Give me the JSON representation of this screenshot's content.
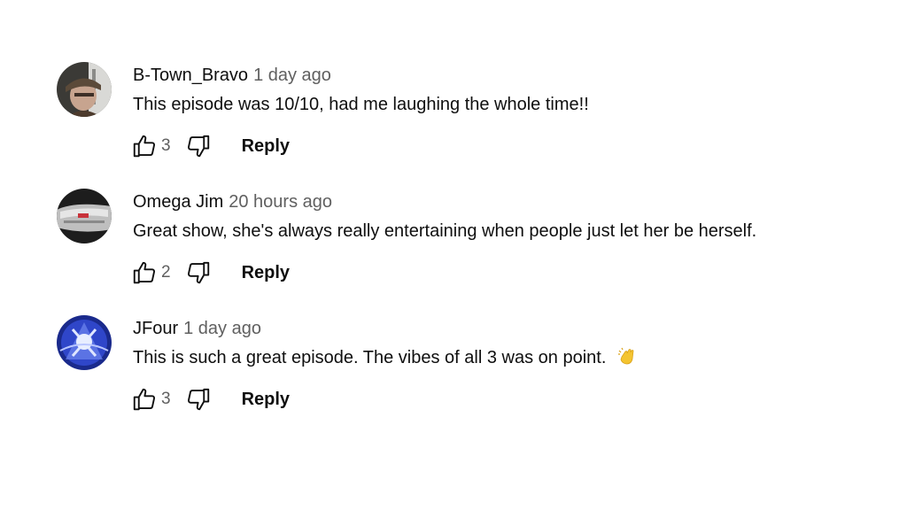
{
  "comments": [
    {
      "author": "B-Town_Bravo",
      "time": "1 day ago",
      "text": "This episode was 10/10, had me laughing the whole time!!",
      "likes": "3",
      "reply_label": "Reply",
      "avatar_icon": "avatar-photo-person-with-cap"
    },
    {
      "author": "Omega Jim",
      "time": "20 hours ago",
      "text": "Great show, she's always really entertaining when people just let her be herself.",
      "likes": "2",
      "reply_label": "Reply",
      "avatar_icon": "avatar-photo-car"
    },
    {
      "author": "JFour",
      "time": "1 day ago",
      "text": "This is such a great episode. The vibes of all 3 was on point.",
      "emoji": "clapping-hands-emoji",
      "likes": "3",
      "reply_label": "Reply",
      "avatar_icon": "avatar-illustration-blue"
    }
  ],
  "colors": {
    "text_primary": "#0f0f0f",
    "text_secondary": "#606060",
    "emoji_yellow": "#f4c430"
  }
}
